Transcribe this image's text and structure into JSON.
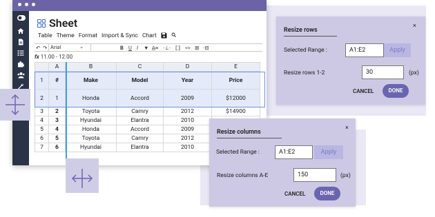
{
  "app": {
    "title": "Sheet"
  },
  "menu": [
    "Table",
    "Theme",
    "Format",
    "Import & Sync",
    "Chart"
  ],
  "toolbar": {
    "undo": "↶",
    "redo": "↷",
    "font": "Arial",
    "font_caret": "⌄",
    "bold": "B",
    "underline": "U",
    "italic": "I",
    "fill": "▼",
    "align": "A̲≡",
    "more1": "⋅⊥⋅",
    "link": "⟦⟧",
    "code": "<>",
    "table": "⊞",
    "more2": "⋅⊟"
  },
  "formula": {
    "prefix": "fx",
    "value": "11.00 - 12.00"
  },
  "grid": {
    "col_headers": [
      "",
      "A",
      "B",
      "C",
      "D",
      "E"
    ],
    "header_row": {
      "n": "1",
      "a": "#",
      "b": "Make",
      "c": "Model",
      "d": "Year",
      "e": "Price"
    },
    "rows": [
      {
        "n": "2",
        "a": "1",
        "b": "Honda",
        "c": "Accord",
        "d": "2009",
        "e": "$12000"
      },
      {
        "n": "3",
        "a": "2",
        "b": "Toyota",
        "c": "Camry",
        "d": "2012",
        "e": "$14900"
      },
      {
        "n": "4",
        "a": "3",
        "b": "Hyundai",
        "c": "Elantra",
        "d": "2010",
        "e": ""
      },
      {
        "n": "5",
        "a": "4",
        "b": "Honda",
        "c": "Accord",
        "d": "2009",
        "e": ""
      },
      {
        "n": "6",
        "a": "5",
        "b": "Toyota",
        "c": "Camry",
        "d": "2012",
        "e": ""
      },
      {
        "n": "7",
        "a": "6",
        "b": "Hyundai",
        "c": "Elantra",
        "d": "2010",
        "e": ""
      }
    ]
  },
  "resize_rows": {
    "title": "Resize rows",
    "close": "×",
    "range_label": "Selected Range :",
    "range_value": "A1:E2",
    "apply": "Apply",
    "size_label": "Resize rows 1-2",
    "size_value": "30",
    "unit": "(px)",
    "cancel": "CANCEL",
    "done": "DONE"
  },
  "resize_cols": {
    "title": "Resize columns",
    "close": "×",
    "range_label": "Selected Range :",
    "range_value": "A1:E2",
    "apply": "Apply",
    "size_label": "Resize columns A-E",
    "size_value": "150",
    "unit": "(px)",
    "cancel": "CANCEL",
    "done": "DONE"
  },
  "colors": {
    "accent": "#6a65b0",
    "titlebar": "#6b63a6",
    "sidebar": "#2b3346",
    "dialog": "#cdc9e4",
    "selection": "#e4eafa"
  },
  "icons": [
    "toggle-icon",
    "home-icon",
    "document-icon",
    "list-icon",
    "puzzle-icon",
    "users-icon",
    "wrench-icon",
    "row-resize-icon",
    "column-resize-icon",
    "sheet-icon",
    "save-icon",
    "search-icon"
  ]
}
